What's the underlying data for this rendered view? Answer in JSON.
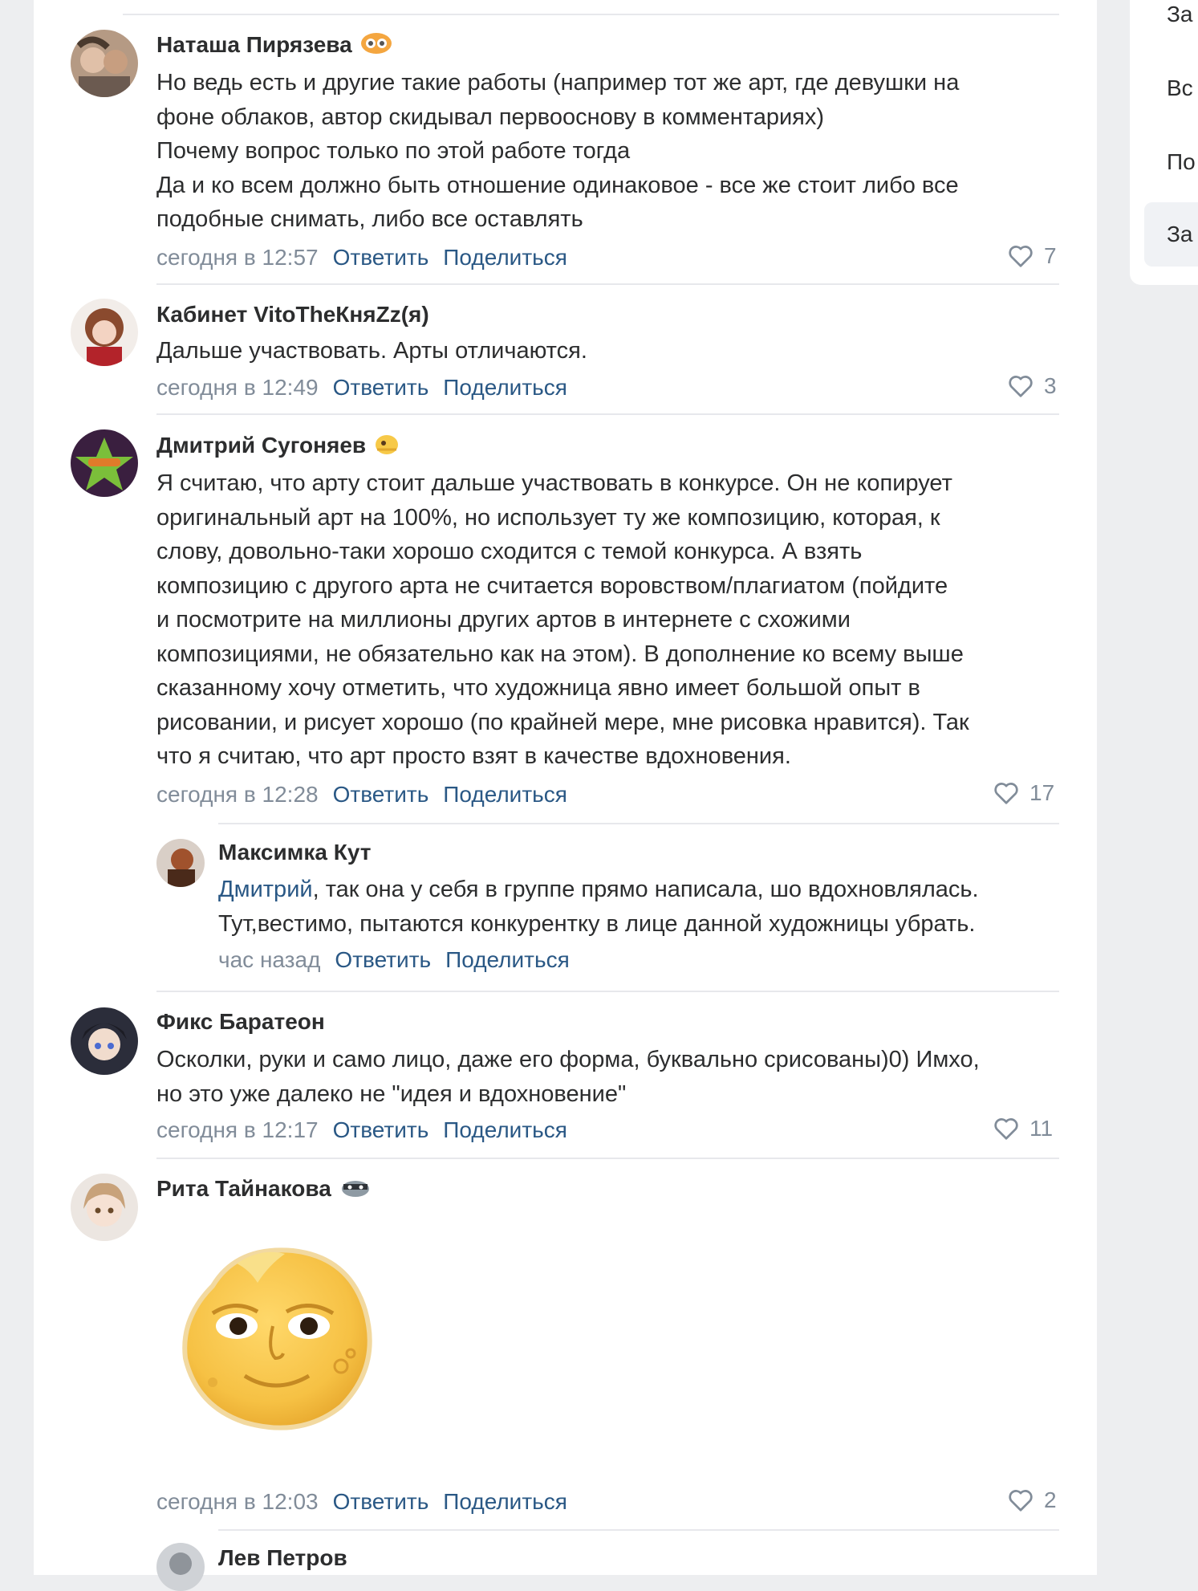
{
  "sidebar": {
    "items": [
      {
        "label": "За"
      },
      {
        "label": "Вс"
      },
      {
        "label": "По"
      },
      {
        "label": "За"
      }
    ]
  },
  "actions": {
    "reply": "Ответить",
    "share": "Поделиться"
  },
  "comments": [
    {
      "author": "Наташа Пирязева",
      "lines": [
        "Но ведь есть и другие такие работы (например тот же арт, где девушки на",
        "фоне облаков, автор скидывал первооснову в комментариях)",
        "Почему вопрос только по этой работе тогда",
        "Да и ко всем должно быть отношение одинаковое - все же стоит либо все",
        "подобные снимать, либо все оставлять"
      ],
      "time": "сегодня в 12:57",
      "likes": "7"
    },
    {
      "author": "Кабинет VitoTheКняZz(я)",
      "lines": [
        "Дальше участвовать. Арты отличаются."
      ],
      "time": "сегодня в 12:49",
      "likes": "3"
    },
    {
      "author": "Дмитрий Сугоняев",
      "lines": [
        "Я считаю, что арту стоит дальше участвовать в конкурсе. Он не копирует",
        "оригинальный арт на 100%, но использует ту же композицию, которая, к",
        "слову, довольно-таки хорошо сходится с темой конкурса. А взять",
        "композицию с другого арта не считается воровством/плагиатом (пойдите",
        "и посмотрите на миллионы других артов в интернете с схожими",
        "композициями, не обязательно как на этом). В дополнение ко всему выше",
        "сказанному хочу отметить, что художница явно имеет большой опыт в",
        "рисовании, и рисует хорошо (по крайней мере, мне рисовка нравится). Так",
        "что я считаю, что арт просто взят в качестве вдохновения."
      ],
      "time": "сегодня в 12:28",
      "likes": "17"
    },
    {
      "author": "Максимка Кут",
      "mention": "Дмитрий",
      "lines": [
        ", так она у себя в группе прямо написала, шо вдохновлялась.",
        "Тут,вестимо, пытаются конкурентку в лице данной художницы убрать."
      ],
      "time": "час назад"
    },
    {
      "author": "Фикс Баратеон",
      "lines": [
        "Осколки, руки и само лицо, даже его форма, буквально срисованы)0) Имхо,",
        "но это уже далеко не \"идея и вдохновение\""
      ],
      "time": "сегодня в 12:17",
      "likes": "11"
    },
    {
      "author": "Рита Тайнакова",
      "sticker": "moon-face-sticker",
      "time": "сегодня в 12:03",
      "likes": "2"
    },
    {
      "author": "Лев Петров"
    }
  ],
  "colors": {
    "link": "#2a5885",
    "meta": "#818c99",
    "text": "#2c2d2e",
    "separator": "#e7e8ec",
    "background": "#edeef0"
  }
}
